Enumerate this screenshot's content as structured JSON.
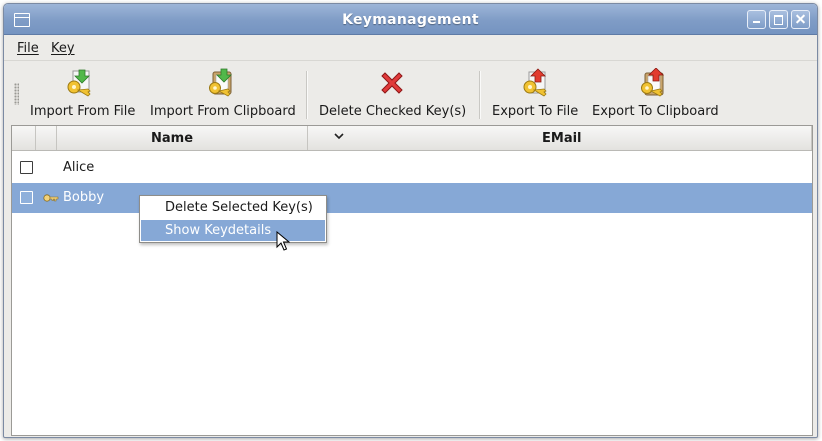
{
  "window": {
    "title": "Keymanagement"
  },
  "menubar": {
    "items": [
      {
        "label": "File"
      },
      {
        "label": "Key"
      }
    ]
  },
  "toolbar": {
    "buttons": [
      {
        "label": "Import From File",
        "icon": "key-import-icon"
      },
      {
        "label": "Import From Clipboard",
        "icon": "clipboard-key-import-icon"
      },
      {
        "label": "Delete Checked Key(s)",
        "icon": "delete-x-icon"
      },
      {
        "label": "Export To File",
        "icon": "key-export-icon"
      },
      {
        "label": "Export To Clipboard",
        "icon": "clipboard-key-export-icon"
      }
    ]
  },
  "list": {
    "columns": [
      {
        "label": "Name",
        "sorted": true
      },
      {
        "label": "EMail"
      }
    ],
    "rows": [
      {
        "name": "Alice",
        "checked": false,
        "selected": false
      },
      {
        "name": "Bobby",
        "checked": false,
        "selected": true,
        "icon": "key-icon"
      }
    ]
  },
  "context_menu": {
    "items": [
      {
        "label": "Delete Selected Key(s)",
        "highlighted": false
      },
      {
        "label": "Show Keydetails",
        "highlighted": true
      }
    ]
  },
  "colors": {
    "titlebar": "#7f9cc6",
    "selection": "#86a8d6",
    "window_bg": "#ecebe8"
  }
}
